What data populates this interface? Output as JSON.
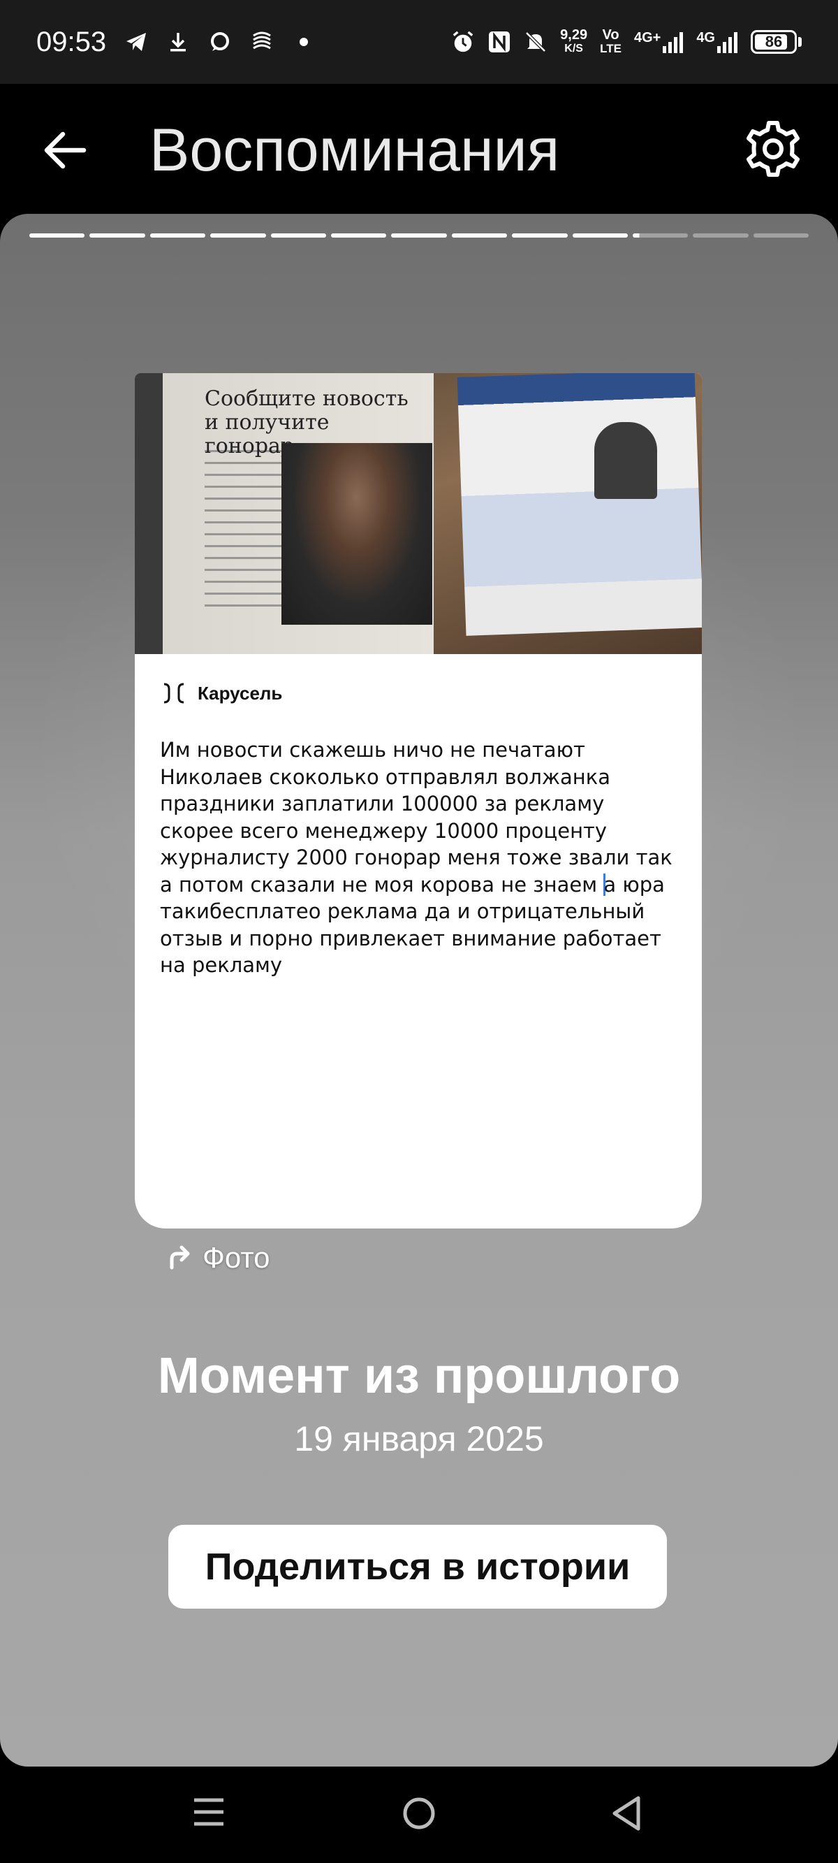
{
  "status_bar": {
    "time": "09:53",
    "net_speed_value": "9,29",
    "net_speed_unit": "K/S",
    "volte_top": "Vo",
    "volte_bottom": "LTE",
    "signal1_label": "4G+",
    "signal2_label": "4G",
    "battery": "86",
    "battery_level": 0.86,
    "icons_left": [
      "telegram-icon",
      "download-icon",
      "chat-icon",
      "wireless-icon",
      "dot-icon"
    ],
    "icons_right": [
      "alarm-icon",
      "nfc-icon",
      "mute-icon"
    ]
  },
  "header": {
    "title": "Воспоминания",
    "back_icon": "arrow-left-icon",
    "settings_icon": "gear-icon"
  },
  "story": {
    "progress_total": 13,
    "progress_done": 10,
    "progress_partial": 1
  },
  "post": {
    "image1_headline": "Сообщите новость и получите гонорар",
    "carousel_label": "Карусель",
    "text_before_cursor": "Им новости скажешь ничо не печатают Николаев скоколько отправлял волжанка праздники заплатили 100000 за рекламу скорее всего менеджеру 10000 проценту журналисту 2000 гонорар меня тоже звали так а потом сказали не моя корова не знаем ",
    "text_after_cursor": "а юра такибесплатео реклама да и отрицательный отзыв и порно привлекает внимание работает на рекламу"
  },
  "photo_link": "Фото",
  "moment": {
    "title": "Момент из прошлого",
    "date": "19 января 2025"
  },
  "share_button": "Поделиться в истории",
  "colors": {
    "status_bg": "#1b1b1b",
    "header_bg": "#000000",
    "cursor": "#3d7bd9"
  }
}
